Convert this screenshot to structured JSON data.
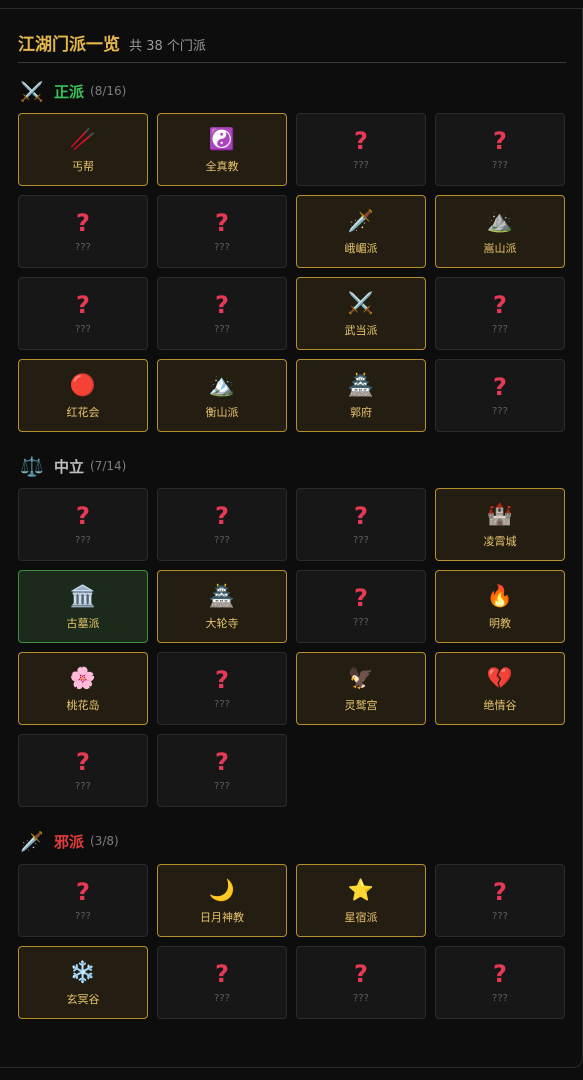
{
  "header": {
    "title": "江湖门派一览",
    "subtitle": "共 38 个门派"
  },
  "categories": [
    {
      "icon": "⚔️",
      "icon_name": "crossed-swords-icon",
      "name": "正派",
      "count": "(8/16)",
      "color": "#38c25a",
      "cards": [
        {
          "icon": "🥢",
          "icon_name": "chopsticks-icon",
          "label": "丐帮",
          "state": "found"
        },
        {
          "icon": "☯️",
          "icon_name": "yin-yang-icon",
          "label": "全真教",
          "state": "found"
        },
        {
          "icon": "?",
          "icon_name": "question-mark-icon",
          "label": "???",
          "state": "unknown"
        },
        {
          "icon": "?",
          "icon_name": "question-mark-icon",
          "label": "???",
          "state": "unknown"
        },
        {
          "icon": "?",
          "icon_name": "question-mark-icon",
          "label": "???",
          "state": "unknown"
        },
        {
          "icon": "?",
          "icon_name": "question-mark-icon",
          "label": "???",
          "state": "unknown"
        },
        {
          "icon": "🗡️",
          "icon_name": "dagger-icon",
          "label": "峨嵋派",
          "state": "found"
        },
        {
          "icon": "⛰️",
          "icon_name": "mountain-icon",
          "label": "嵩山派",
          "state": "found"
        },
        {
          "icon": "?",
          "icon_name": "question-mark-icon",
          "label": "???",
          "state": "unknown"
        },
        {
          "icon": "?",
          "icon_name": "question-mark-icon",
          "label": "???",
          "state": "unknown"
        },
        {
          "icon": "⚔️",
          "icon_name": "crossed-swords-icon",
          "label": "武当派",
          "state": "found"
        },
        {
          "icon": "?",
          "icon_name": "question-mark-icon",
          "label": "???",
          "state": "unknown"
        },
        {
          "icon": "🔴",
          "icon_name": "red-circle-icon",
          "label": "红花会",
          "state": "found"
        },
        {
          "icon": "🏔️",
          "icon_name": "snow-mountain-icon",
          "label": "衡山派",
          "state": "found"
        },
        {
          "icon": "🏯",
          "icon_name": "castle-icon",
          "label": "郭府",
          "state": "found"
        },
        {
          "icon": "?",
          "icon_name": "question-mark-icon",
          "label": "???",
          "state": "unknown"
        }
      ]
    },
    {
      "icon": "⚖️",
      "icon_name": "balance-scale-icon",
      "name": "中立",
      "count": "(7/14)",
      "color": "#bfbfbf",
      "cards": [
        {
          "icon": "?",
          "icon_name": "question-mark-icon",
          "label": "???",
          "state": "unknown"
        },
        {
          "icon": "?",
          "icon_name": "question-mark-icon",
          "label": "???",
          "state": "unknown"
        },
        {
          "icon": "?",
          "icon_name": "question-mark-icon",
          "label": "???",
          "state": "unknown"
        },
        {
          "icon": "🏰",
          "icon_name": "castle-icon",
          "label": "凌霄城",
          "state": "found"
        },
        {
          "icon": "🏛️",
          "icon_name": "classical-building-icon",
          "label": "古墓派",
          "state": "active"
        },
        {
          "icon": "🏯",
          "icon_name": "japanese-castle-icon",
          "label": "大轮寺",
          "state": "found"
        },
        {
          "icon": "?",
          "icon_name": "question-mark-icon",
          "label": "???",
          "state": "unknown"
        },
        {
          "icon": "🔥",
          "icon_name": "fire-icon",
          "label": "明教",
          "state": "found"
        },
        {
          "icon": "🌸",
          "icon_name": "cherry-blossom-icon",
          "label": "桃花岛",
          "state": "found"
        },
        {
          "icon": "?",
          "icon_name": "question-mark-icon",
          "label": "???",
          "state": "unknown"
        },
        {
          "icon": "🦅",
          "icon_name": "eagle-icon",
          "label": "灵鹫宫",
          "state": "found"
        },
        {
          "icon": "💔",
          "icon_name": "broken-heart-icon",
          "label": "绝情谷",
          "state": "found"
        },
        {
          "icon": "?",
          "icon_name": "question-mark-icon",
          "label": "???",
          "state": "unknown"
        },
        {
          "icon": "?",
          "icon_name": "question-mark-icon",
          "label": "???",
          "state": "unknown"
        }
      ]
    },
    {
      "icon": "🗡️",
      "icon_name": "dagger-icon",
      "name": "邪派",
      "count": "(3/8)",
      "color": "#e23d3d",
      "cards": [
        {
          "icon": "?",
          "icon_name": "question-mark-icon",
          "label": "???",
          "state": "unknown"
        },
        {
          "icon": "🌙",
          "icon_name": "crescent-moon-icon",
          "label": "日月神教",
          "state": "found"
        },
        {
          "icon": "⭐",
          "icon_name": "star-icon",
          "label": "星宿派",
          "state": "found"
        },
        {
          "icon": "?",
          "icon_name": "question-mark-icon",
          "label": "???",
          "state": "unknown"
        },
        {
          "icon": "❄️",
          "icon_name": "snowflake-icon",
          "label": "玄冥谷",
          "state": "found"
        },
        {
          "icon": "?",
          "icon_name": "question-mark-icon",
          "label": "???",
          "state": "unknown"
        },
        {
          "icon": "?",
          "icon_name": "question-mark-icon",
          "label": "???",
          "state": "unknown"
        },
        {
          "icon": "?",
          "icon_name": "question-mark-icon",
          "label": "???",
          "state": "unknown"
        }
      ]
    }
  ]
}
